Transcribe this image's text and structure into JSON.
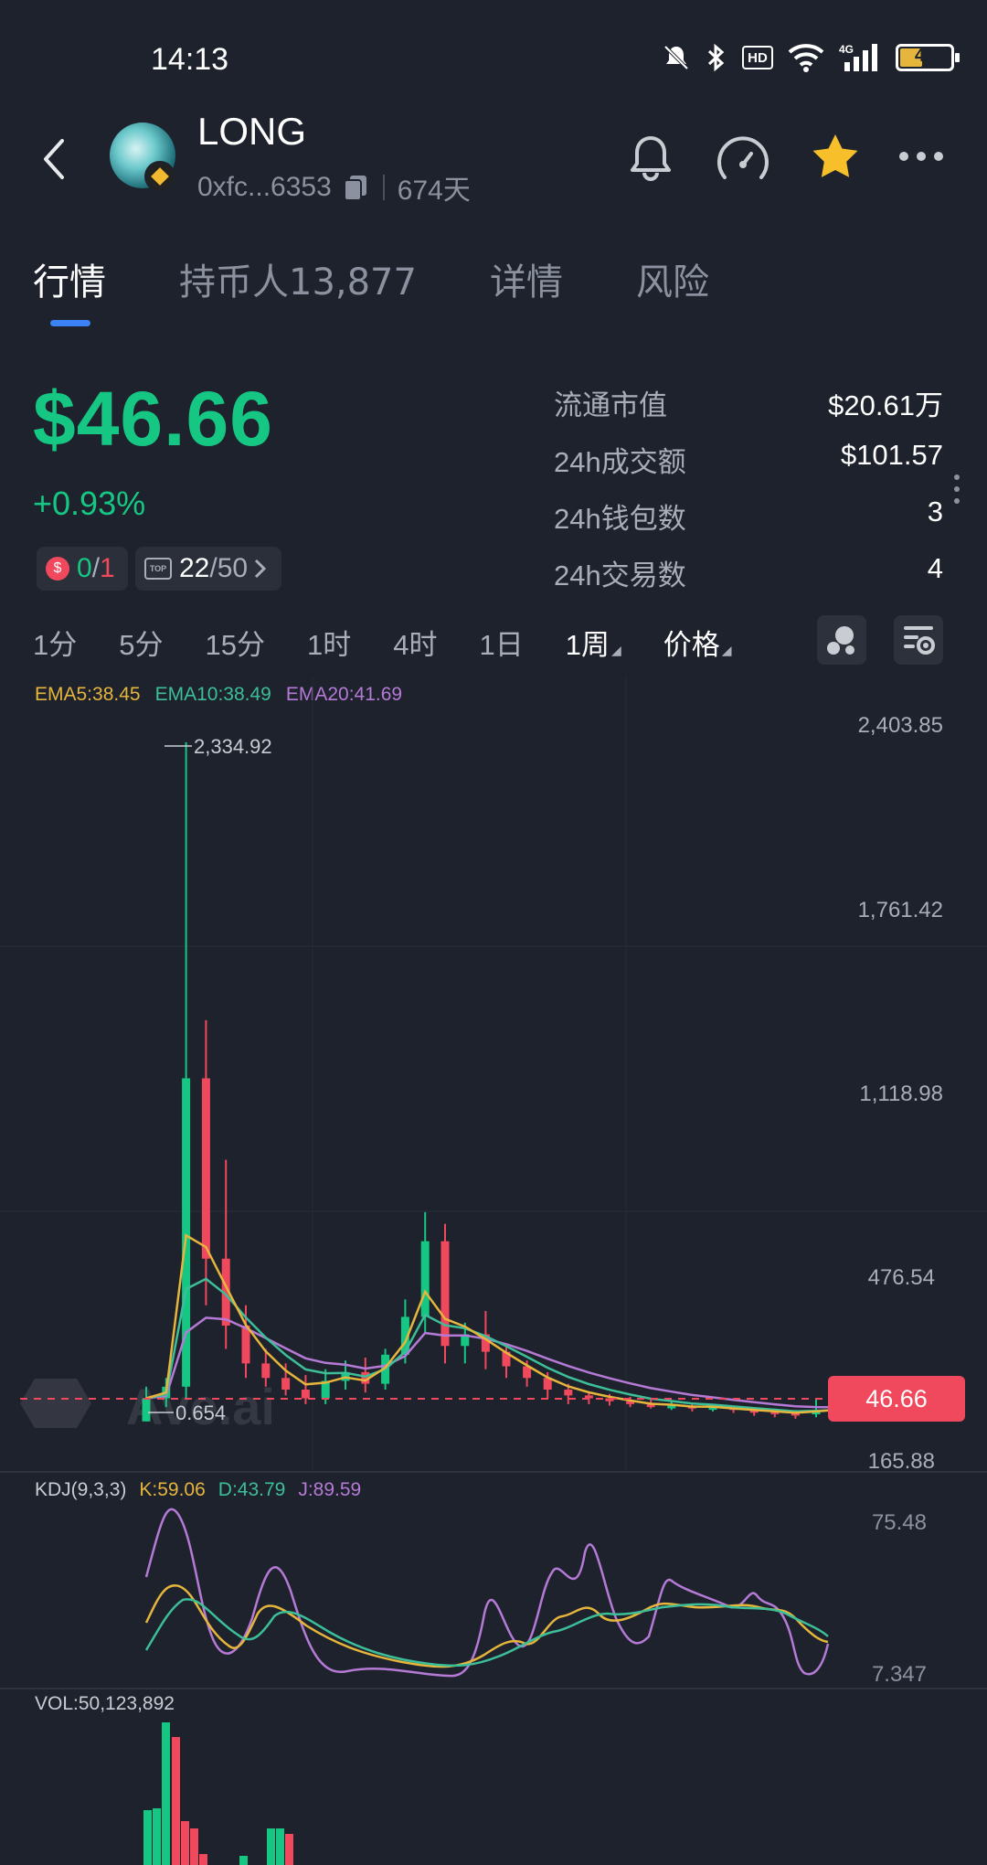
{
  "status": {
    "time": "14:13",
    "battery": "43"
  },
  "header": {
    "title": "LONG",
    "address": "0xfc...6353",
    "age": "674天"
  },
  "tabs": [
    {
      "label": "行情",
      "active": true
    },
    {
      "label": "持币人13,877",
      "active": false
    },
    {
      "label": "详情",
      "active": false
    },
    {
      "label": "风险",
      "active": false
    }
  ],
  "price": {
    "value": "$46.66",
    "change": "+0.93%"
  },
  "badges": {
    "risk_green": "0",
    "risk_sep": "/",
    "risk_red": "1",
    "top_value": "22",
    "top_total": "/50"
  },
  "stats": [
    {
      "label": "流通市值",
      "value": "$20.61万"
    },
    {
      "label": "24h成交额",
      "value": "$101.57"
    },
    {
      "label": "24h钱包数",
      "value": "3"
    },
    {
      "label": "24h交易数",
      "value": "4"
    }
  ],
  "intervals": [
    {
      "label": "1分",
      "active": false
    },
    {
      "label": "5分",
      "active": false
    },
    {
      "label": "15分",
      "active": false
    },
    {
      "label": "1时",
      "active": false
    },
    {
      "label": "4时",
      "active": false
    },
    {
      "label": "1日",
      "active": false
    },
    {
      "label": "1周",
      "active": true
    },
    {
      "label": "价格",
      "active": false
    }
  ],
  "ema": {
    "ema5": "EMA5:38.45",
    "ema10": "EMA10:38.49",
    "ema20": "EMA20:41.69"
  },
  "colors": {
    "up": "#16c784",
    "down": "#f0485c",
    "ema5": "#e5b53c",
    "ema10": "#3cbf98",
    "ema20": "#b57ad6",
    "bg": "#1e222c"
  },
  "price_axis": [
    "2,403.85",
    "1,761.42",
    "1,118.98",
    "476.54",
    "165.88"
  ],
  "annotations": {
    "high": "2,334.92",
    "low": "0.654",
    "current_tag": "46.66"
  },
  "kdj": {
    "label": "KDJ(9,3,3)",
    "k": "K:59.06",
    "d": "D:43.79",
    "j": "J:89.59",
    "axis_top": "75.48",
    "axis_bottom": "7.347"
  },
  "vol": {
    "label": "VOL:50,123,892"
  },
  "watermark": "Ave.ai",
  "chart_data": {
    "type": "candlestick",
    "ylim": [
      165.88,
      2403.85
    ],
    "candles": [
      [
        0.654,
        80,
        0.654,
        120,
        "up"
      ],
      [
        80,
        120,
        50,
        150,
        "up"
      ],
      [
        120,
        1180,
        80,
        2334.92,
        "up"
      ],
      [
        1180,
        560,
        400,
        1380,
        "down"
      ],
      [
        560,
        330,
        250,
        900,
        "down"
      ],
      [
        330,
        200,
        150,
        400,
        "down"
      ],
      [
        200,
        150,
        120,
        250,
        "down"
      ],
      [
        150,
        110,
        90,
        200,
        "down"
      ],
      [
        110,
        80,
        60,
        160,
        "down"
      ],
      [
        80,
        140,
        60,
        180,
        "up"
      ],
      [
        140,
        170,
        110,
        210,
        "up"
      ],
      [
        170,
        130,
        100,
        220,
        "down"
      ],
      [
        130,
        230,
        110,
        250,
        "up"
      ],
      [
        230,
        360,
        200,
        420,
        "up"
      ],
      [
        360,
        620,
        300,
        720,
        "up"
      ],
      [
        620,
        260,
        200,
        680,
        "down"
      ],
      [
        260,
        300,
        200,
        340,
        "up"
      ],
      [
        300,
        240,
        180,
        380,
        "down"
      ],
      [
        240,
        190,
        150,
        260,
        "down"
      ],
      [
        190,
        150,
        120,
        210,
        "down"
      ],
      [
        150,
        110,
        80,
        170,
        "down"
      ],
      [
        110,
        90,
        60,
        130,
        "down"
      ],
      [
        90,
        80,
        60,
        100,
        "down"
      ],
      [
        80,
        70,
        55,
        95,
        "down"
      ],
      [
        70,
        60,
        50,
        85,
        "down"
      ],
      [
        60,
        50,
        45,
        75,
        "down"
      ],
      [
        50,
        55,
        40,
        70,
        "up"
      ],
      [
        55,
        45,
        35,
        65,
        "down"
      ],
      [
        45,
        50,
        35,
        60,
        "up"
      ],
      [
        50,
        40,
        30,
        55,
        "down"
      ],
      [
        40,
        35,
        20,
        50,
        "down"
      ],
      [
        35,
        30,
        15,
        45,
        "down"
      ],
      [
        30,
        25,
        10,
        40,
        "down"
      ],
      [
        25,
        40,
        15,
        80,
        "up"
      ],
      [
        40,
        46.66,
        30,
        70,
        "up"
      ]
    ]
  }
}
